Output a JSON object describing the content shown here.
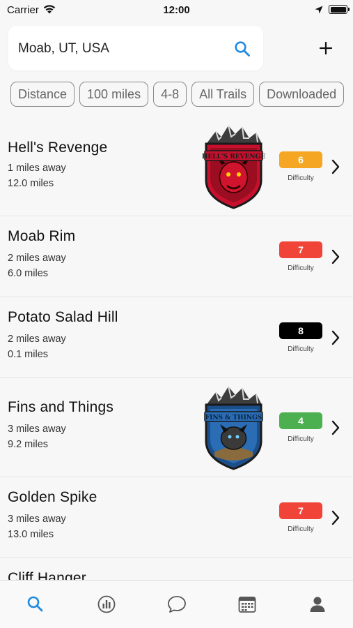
{
  "status_bar": {
    "carrier": "Carrier",
    "time": "12:00"
  },
  "search": {
    "value": "Moab, UT, USA"
  },
  "filters": [
    "Distance",
    "100 miles",
    "4-8",
    "All Trails",
    "Downloaded"
  ],
  "difficulty_label": "Difficulty",
  "trails": [
    {
      "name": "Hell's Revenge",
      "away": "1 miles away",
      "length": "12.0 miles",
      "difficulty": "6",
      "color": "#f5a623",
      "logo": "hells-revenge-logo",
      "logo_text": "HELL'S REVENGE"
    },
    {
      "name": "Moab Rim",
      "away": "2 miles away",
      "length": "6.0 miles",
      "difficulty": "7",
      "color": "#f04438"
    },
    {
      "name": "Potato Salad Hill",
      "away": "2 miles away",
      "length": "0.1 miles",
      "difficulty": "8",
      "color": "#000000"
    },
    {
      "name": "Fins and Things",
      "away": "3 miles away",
      "length": "9.2 miles",
      "difficulty": "4",
      "color": "#4caf50",
      "logo": "fins-and-things-logo",
      "logo_text": "FINS & THINGS"
    },
    {
      "name": "Golden Spike",
      "away": "3 miles away",
      "length": "13.0 miles",
      "difficulty": "7",
      "color": "#f04438"
    },
    {
      "name": "Cliff Hanger"
    }
  ],
  "tab_bar": [
    "search-icon",
    "stats-icon",
    "chat-icon",
    "calendar-icon",
    "profile-icon"
  ],
  "colors": {
    "accent": "#1e8ae0",
    "background": "#f7f7f7"
  }
}
